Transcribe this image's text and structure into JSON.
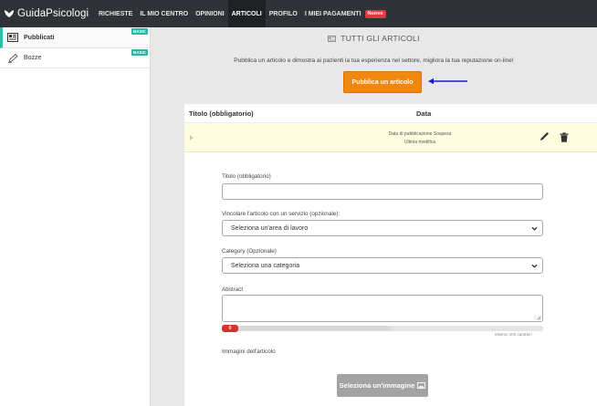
{
  "app": {
    "logo": "GuidaPsicologi",
    "accent": "#2dbfa8",
    "cta_color": "#f0870e"
  },
  "nav": {
    "items": [
      {
        "label": "RICHIESTE"
      },
      {
        "label": "IL MIO CENTRO"
      },
      {
        "label": "OPINIONI"
      },
      {
        "label": "ARTICOLI"
      },
      {
        "label": "PROFILO"
      },
      {
        "label": "I MIEI PAGAMENTI"
      }
    ],
    "new_badge": "Nuovo"
  },
  "sidebar": {
    "items": [
      {
        "label": "Pubblicati",
        "badge": "BASIC",
        "icon": "published-list-icon"
      },
      {
        "label": "Bozze",
        "badge": "BASIC",
        "icon": "pencil-icon"
      }
    ]
  },
  "main": {
    "title": "TUTTI GLI ARTICOLI",
    "intro": "Pubblica un articolo e dimostra ai pazienti la tua esperienza nel settore, migliora la tua reputazione on-line!",
    "cta_label": "Pubblica un articolo",
    "table": {
      "col_title": "Titolo (obbligatorio)",
      "col_date": "Data",
      "row": {
        "line1": "Data di pubblicazione Sospesa",
        "line2": "Ultima modifica"
      }
    },
    "form": {
      "title_label": "Titolo (obbligatorio)",
      "title_value": "",
      "service_label": "Vincolare l'articolo con un servizio (opzionale):",
      "service_value": "Seleziona un'area di lavoro",
      "category_label": "Category (Opzionale)",
      "category_value": "Seleziona una categoria",
      "abstract_label": "Abstract",
      "abstract_count": "0",
      "abstract_min": "Minimo 100 caratteri",
      "images_label": "Immagini dell'articolo",
      "image_button": "Seleziona un'immagine"
    }
  }
}
